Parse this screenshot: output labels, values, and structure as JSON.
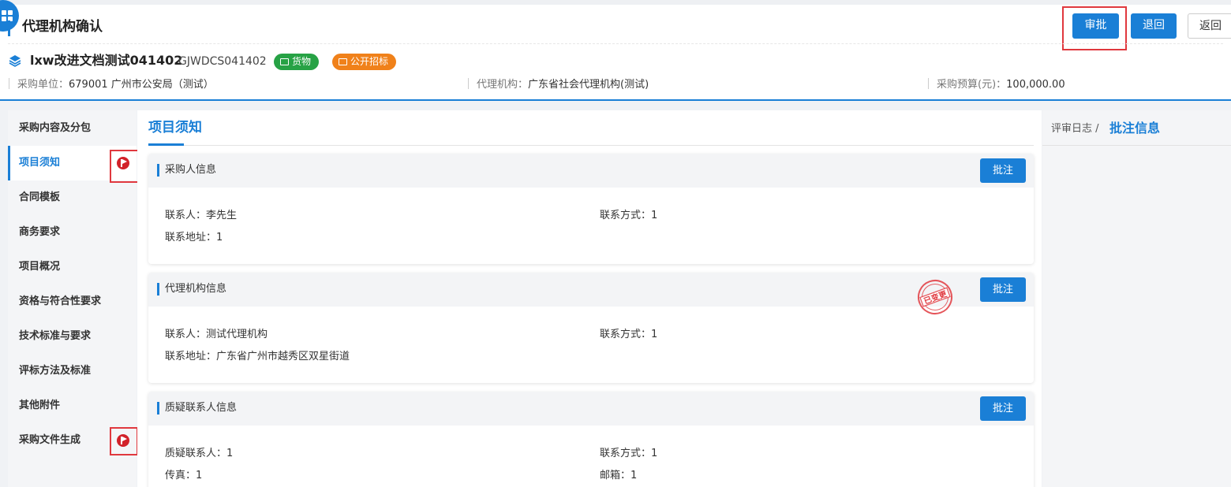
{
  "header": {
    "title": "代理机构确认",
    "buttons": {
      "approve": "审批",
      "return_back": "退回",
      "go_back": "返回"
    }
  },
  "project": {
    "name": "lxw改进文档测试041402",
    "code": "GJWDCS041402",
    "tags": [
      {
        "label": "货物",
        "color": "#27a245"
      },
      {
        "label": "公开招标",
        "color": "#f0811a"
      }
    ],
    "meta": [
      {
        "label": "采购单位：",
        "value": "679001 广州市公安局（测试）"
      },
      {
        "label": "代理机构：",
        "value": "广东省社会代理机构(测试)"
      },
      {
        "label": "采购预算(元)：",
        "value": "100,000.00"
      }
    ]
  },
  "sidebar": {
    "items": [
      {
        "label": "采购内容及分包"
      },
      {
        "label": "项目须知",
        "active": true,
        "flag": true
      },
      {
        "label": "合同模板"
      },
      {
        "label": "商务要求"
      },
      {
        "label": "项目概况"
      },
      {
        "label": "资格与符合性要求"
      },
      {
        "label": "技术标准与要求"
      },
      {
        "label": "评标方法及标准"
      },
      {
        "label": "其他附件"
      },
      {
        "label": "采购文件生成",
        "flag": true
      }
    ]
  },
  "main": {
    "tab": "项目须知",
    "annotate_label": "批注",
    "cards": [
      {
        "title": "采购人信息",
        "fields": [
          "联系人：李先生",
          "联系方式：1",
          "联系地址：1"
        ]
      },
      {
        "title": "代理机构信息",
        "stamp": "已变更",
        "fields": [
          "联系人：测试代理机构",
          "联系方式：1",
          "联系地址：广东省广州市越秀区双星街道"
        ]
      },
      {
        "title": "质疑联系人信息",
        "fields": [
          "质疑联系人：1",
          "联系方式：1",
          "传真：1",
          "邮箱：1"
        ]
      }
    ]
  },
  "right_panel": {
    "breadcrumb": "评审日志 /",
    "current": "批注信息"
  },
  "colors": {
    "primary": "#1a7fd6",
    "highlight": "#e0383e",
    "flag": "#d2222a"
  }
}
